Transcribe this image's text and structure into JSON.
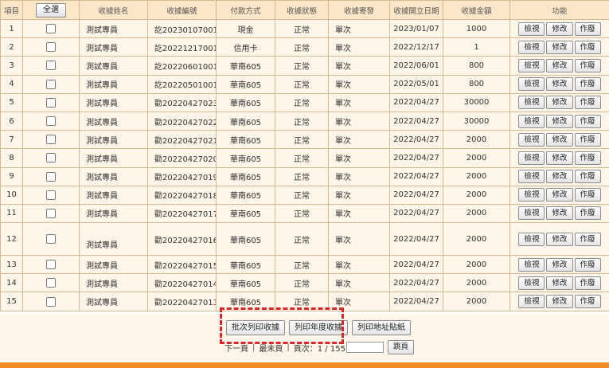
{
  "header": {
    "item": "項目",
    "select_all": "全選",
    "name": "收據姓名",
    "number": "收據編號",
    "payment": "付款方式",
    "status": "收據狀態",
    "sending": "收據寄發",
    "date": "收據開立日期",
    "amount": "收據金額",
    "actions": "功能"
  },
  "action_labels": {
    "view": "檢視",
    "edit": "修改",
    "void": "作廢"
  },
  "rows": [
    {
      "item": "1",
      "name": "測試專員",
      "number": "訖20230107001",
      "payment": "現金",
      "status": "正常",
      "sending": "單次",
      "date": "2023/01/07",
      "amount": "1000"
    },
    {
      "item": "2",
      "name": "測試專員",
      "number": "訖20221217001",
      "payment": "信用卡",
      "status": "正常",
      "sending": "單次",
      "date": "2022/12/17",
      "amount": "1"
    },
    {
      "item": "3",
      "name": "測試專員",
      "number": "訖20220601001",
      "payment": "華南605",
      "status": "正常",
      "sending": "單次",
      "date": "2022/06/01",
      "amount": "800"
    },
    {
      "item": "4",
      "name": "測試專員",
      "number": "訖20220501001",
      "payment": "華南605",
      "status": "正常",
      "sending": "單次",
      "date": "2022/05/01",
      "amount": "800"
    },
    {
      "item": "5",
      "name": "測試專員",
      "number": "勸20220427023",
      "payment": "華南605",
      "status": "正常",
      "sending": "單次",
      "date": "2022/04/27",
      "amount": "30000"
    },
    {
      "item": "6",
      "name": "測試專員",
      "number": "勸20220427022",
      "payment": "華南605",
      "status": "正常",
      "sending": "單次",
      "date": "2022/04/27",
      "amount": "30000"
    },
    {
      "item": "7",
      "name": "測試專員",
      "number": "勸20220427021",
      "payment": "華南605",
      "status": "正常",
      "sending": "單次",
      "date": "2022/04/27",
      "amount": "2000"
    },
    {
      "item": "8",
      "name": "測試專員",
      "number": "勸20220427020",
      "payment": "華南605",
      "status": "正常",
      "sending": "單次",
      "date": "2022/04/27",
      "amount": "2000"
    },
    {
      "item": "9",
      "name": "測試專員",
      "number": "勸20220427019",
      "payment": "華南605",
      "status": "正常",
      "sending": "單次",
      "date": "2022/04/27",
      "amount": "2000"
    },
    {
      "item": "10",
      "name": "測試專員",
      "number": "勸20220427018",
      "payment": "華南605",
      "status": "正常",
      "sending": "單次",
      "date": "2022/04/27",
      "amount": "2000"
    },
    {
      "item": "11",
      "name": "測試專員",
      "number": "勸20220427017",
      "payment": "華南605",
      "status": "正常",
      "sending": "單次",
      "date": "2022/04/27",
      "amount": "2000"
    },
    {
      "item": "12",
      "name": "測試專員",
      "number": "勸20220427016",
      "payment": "華南605",
      "status": "正常",
      "sending": "單次",
      "date": "2022/04/27",
      "amount": "2000"
    },
    {
      "item": "13",
      "name": "測試專員",
      "number": "勸20220427015",
      "payment": "華南605",
      "status": "正常",
      "sending": "單次",
      "date": "2022/04/27",
      "amount": "2000"
    },
    {
      "item": "14",
      "name": "測試專員",
      "number": "勸20220427014",
      "payment": "華南605",
      "status": "正常",
      "sending": "單次",
      "date": "2022/04/27",
      "amount": "2000"
    },
    {
      "item": "15",
      "name": "測試專員",
      "number": "勸20220427013",
      "payment": "華南605",
      "status": "正常",
      "sending": "單次",
      "date": "2022/04/27",
      "amount": "2000"
    }
  ],
  "bulk": {
    "batch_print": "批次列印收據",
    "annual_print": "列印年度收據",
    "label_print": "列印地址貼紙"
  },
  "pager": {
    "next": "下一頁",
    "last": "最末頁",
    "page_label": "頁次：1 / 155",
    "goto_value": "",
    "goto_button": "跳頁"
  },
  "colors": {
    "header_bg": "#fbe6c8",
    "row_bg": "#fff5e8",
    "border": "#d6b98f",
    "highlight_dash": "#d9262b",
    "bottom_bar": "#f08a23"
  }
}
